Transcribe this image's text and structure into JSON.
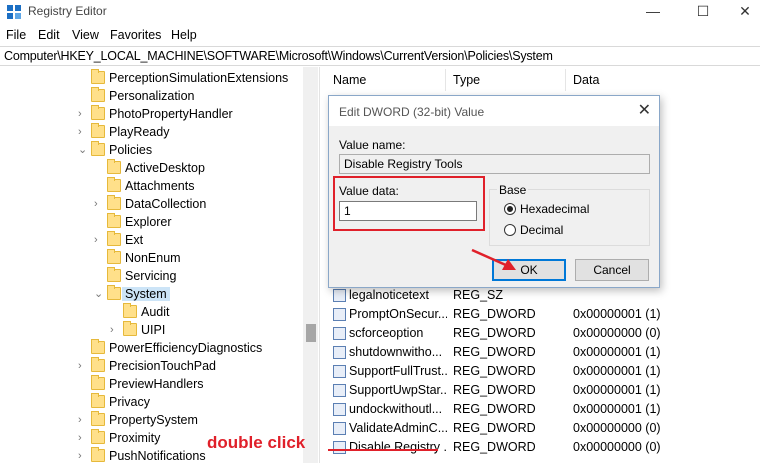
{
  "window": {
    "title": "Registry Editor",
    "minimize_glyph": "—",
    "maximize_glyph": "☐",
    "close_glyph": "✕"
  },
  "menu": [
    "File",
    "Edit",
    "View",
    "Favorites",
    "Help"
  ],
  "address": "Computer\\HKEY_LOCAL_MACHINE\\SOFTWARE\\Microsoft\\Windows\\CurrentVersion\\Policies\\System",
  "tree": [
    {
      "label": "PerceptionSimulationExtensions",
      "chevron": "",
      "level": 0
    },
    {
      "label": "Personalization",
      "chevron": "",
      "level": 0
    },
    {
      "label": "PhotoPropertyHandler",
      "chevron": "›",
      "level": 0
    },
    {
      "label": "PlayReady",
      "chevron": "›",
      "level": 0
    },
    {
      "label": "Policies",
      "chevron": "⌄",
      "level": 0
    },
    {
      "label": "ActiveDesktop",
      "chevron": "",
      "level": 1
    },
    {
      "label": "Attachments",
      "chevron": "",
      "level": 1
    },
    {
      "label": "DataCollection",
      "chevron": "›",
      "level": 1
    },
    {
      "label": "Explorer",
      "chevron": "",
      "level": 1
    },
    {
      "label": "Ext",
      "chevron": "›",
      "level": 1
    },
    {
      "label": "NonEnum",
      "chevron": "",
      "level": 1
    },
    {
      "label": "Servicing",
      "chevron": "",
      "level": 1
    },
    {
      "label": "System",
      "chevron": "⌄",
      "level": 1,
      "selected": true
    },
    {
      "label": "Audit",
      "chevron": "",
      "level": 2
    },
    {
      "label": "UIPI",
      "chevron": "›",
      "level": 2
    },
    {
      "label": "PowerEfficiencyDiagnostics",
      "chevron": "",
      "level": 0
    },
    {
      "label": "PrecisionTouchPad",
      "chevron": "›",
      "level": 0
    },
    {
      "label": "PreviewHandlers",
      "chevron": "",
      "level": 0
    },
    {
      "label": "Privacy",
      "chevron": "",
      "level": 0
    },
    {
      "label": "PropertySystem",
      "chevron": "›",
      "level": 0
    },
    {
      "label": "Proximity",
      "chevron": "›",
      "level": 0
    },
    {
      "label": "PushNotifications",
      "chevron": "›",
      "level": 0
    }
  ],
  "values_header": {
    "name": "Name",
    "type": "Type",
    "data": "Data"
  },
  "values": [
    {
      "name": "legalnoticetext",
      "type": "REG_SZ",
      "data": ""
    },
    {
      "name": "PromptOnSecur...",
      "type": "REG_DWORD",
      "data": "0x00000001 (1)"
    },
    {
      "name": "scforceoption",
      "type": "REG_DWORD",
      "data": "0x00000000 (0)"
    },
    {
      "name": "shutdownwitho...",
      "type": "REG_DWORD",
      "data": "0x00000001 (1)"
    },
    {
      "name": "SupportFullTrust...",
      "type": "REG_DWORD",
      "data": "0x00000001 (1)"
    },
    {
      "name": "SupportUwpStar...",
      "type": "REG_DWORD",
      "data": "0x00000001 (1)"
    },
    {
      "name": "undockwithoutl...",
      "type": "REG_DWORD",
      "data": "0x00000001 (1)"
    },
    {
      "name": "ValidateAdminC...",
      "type": "REG_DWORD",
      "data": "0x00000000 (0)"
    },
    {
      "name": "Disable Registry ...",
      "type": "REG_DWORD",
      "data": "0x00000000 (0)"
    }
  ],
  "dialog": {
    "title": "Edit DWORD (32-bit) Value",
    "close_glyph": "✕",
    "value_name_label": "Value name:",
    "value_name": "Disable Registry Tools",
    "value_data_label": "Value data:",
    "value_data": "1",
    "base_label": "Base",
    "hex_label": "Hexadecimal",
    "dec_label": "Decimal",
    "base_selected": "Hexadecimal",
    "ok_label": "OK",
    "cancel_label": "Cancel"
  },
  "annotation": {
    "text": "double click",
    "color": "#e0202a"
  },
  "colors": {
    "accent": "#0078d7",
    "selection": "#cce4f7",
    "folder": "#ffe08a",
    "annotation_red": "#e0202a"
  }
}
